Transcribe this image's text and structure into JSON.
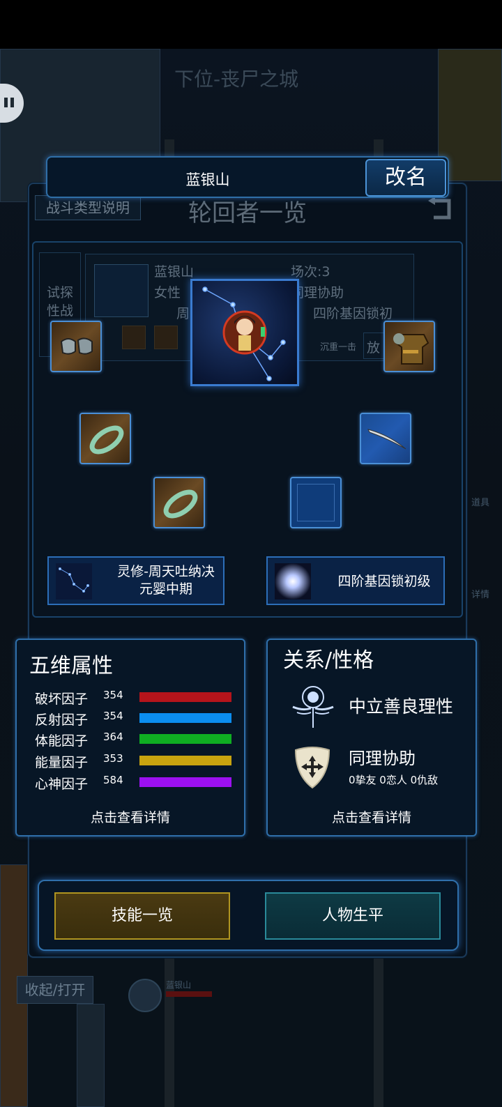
{
  "background": {
    "city_title": "下位-丧尸之城",
    "collapse_button": "收起/打开",
    "side_items_label": "道具",
    "side_details_label": "详情",
    "map_name_tag": "蓝银山"
  },
  "rename_bar": {
    "character_name": "蓝银山",
    "rename_button": "改名"
  },
  "panel": {
    "title": "轮回者一览",
    "battle_type_button": "战斗类型说明"
  },
  "character_card": {
    "left_label": "试探性战斗",
    "name": "蓝银山",
    "gender": "女性",
    "cultivation_short": "周",
    "rounds": "场次:3",
    "trait": "同理协助",
    "gene_lock": "四阶基因锁初",
    "skill_tag": "沉重一击",
    "extra_btn": "放"
  },
  "equipment": {
    "slots": [
      {
        "name": "gauntlets",
        "icon": "gauntlets-icon"
      },
      {
        "name": "armor",
        "icon": "armor-icon"
      },
      {
        "name": "jade-bracelet-1",
        "icon": "jade-bracelet-icon"
      },
      {
        "name": "blade",
        "icon": "blade-icon"
      },
      {
        "name": "jade-bracelet-2",
        "icon": "jade-bracelet-icon"
      },
      {
        "name": "empty",
        "icon": "empty-slot"
      }
    ]
  },
  "abilities": {
    "cultivation_line1": "灵修-周天吐纳决",
    "cultivation_line2": "元婴中期",
    "gene_lock": "四阶基因锁初级"
  },
  "attributes": {
    "title": "五维属性",
    "stats": [
      {
        "name": "破坏因子",
        "value": "354",
        "color": "#b5141b"
      },
      {
        "name": "反射因子",
        "value": "354",
        "color": "#0b8ef0"
      },
      {
        "name": "体能因子",
        "value": "364",
        "color": "#0fae22"
      },
      {
        "name": "能量因子",
        "value": "353",
        "color": "#c9a40f"
      },
      {
        "name": "心神因子",
        "value": "584",
        "color": "#9b10f0"
      }
    ],
    "detail_link": "点击查看详情"
  },
  "relations": {
    "title": "关系/性格",
    "alignment": "中立善良理性",
    "personality": "同理协助",
    "relation_counts": "0挚友 0恋人 0仇敌",
    "detail_link": "点击查看详情"
  },
  "buttons": {
    "skills": "技能一览",
    "biography": "人物生平"
  }
}
